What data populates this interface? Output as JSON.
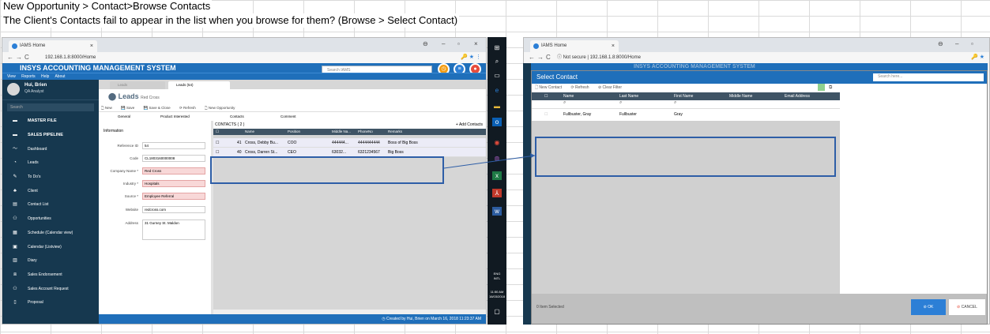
{
  "headings": {
    "line1": "New Opportunity > Contact>Browse Contacts",
    "line2": "The Client's Contacts fail to appear in the list when you browse for them? (Browse > Select Contact)"
  },
  "left": {
    "tab_title": "IAMS Home",
    "url": "192.168.1.8:8000/Home",
    "app_title": "INSYS ACCOUNTING MANAGEMENT SYSTEM",
    "menu": [
      "View",
      "Reports",
      "Help",
      "About"
    ],
    "search_placeholder": "Search IAMS",
    "user": {
      "name": "Hui, Brien",
      "role": "QA Analyst"
    },
    "sidebar_search": "Search",
    "sidebar_items": [
      {
        "label": "MASTER FILE",
        "icon": "folder-icon"
      },
      {
        "label": "SALES PIPELINE",
        "icon": "folder-open-icon"
      },
      {
        "label": "Dashboard",
        "icon": "chart-line-icon"
      },
      {
        "label": "Leads",
        "icon": "leads-icon"
      },
      {
        "label": "To Do's",
        "icon": "pencil-icon"
      },
      {
        "label": "Client",
        "icon": "users-icon"
      },
      {
        "label": "Contact List",
        "icon": "contact-card-icon"
      },
      {
        "label": "Opportunities",
        "icon": "people-icon"
      },
      {
        "label": "Schedule (Calendar view)",
        "icon": "calendar-icon"
      },
      {
        "label": "Calendar (Listview)",
        "icon": "calendar-list-icon"
      },
      {
        "label": "Diary",
        "icon": "book-icon"
      },
      {
        "label": "Sales Endorsement",
        "icon": "sitemap-icon"
      },
      {
        "label": "Sales Account Request",
        "icon": "user-plus-icon"
      },
      {
        "label": "Proposal",
        "icon": "document-icon"
      }
    ],
    "content_tabs": [
      "Leads",
      "Leads (54)"
    ],
    "leads_title": "Leads",
    "leads_sub": "Red Cross",
    "toolbar": [
      "New",
      "Save",
      "Save & Close",
      "Refresh",
      "New Opportunity"
    ],
    "subtabs": [
      "General",
      "Product Interested",
      "Contacts",
      "Comment"
    ],
    "info_label": "Information",
    "form": [
      {
        "label": "Reference ID",
        "value": "54",
        "red": false
      },
      {
        "label": "Code",
        "value": "CL1803160000008",
        "red": false
      },
      {
        "label": "Company Name *",
        "value": "Red Cross",
        "red": true
      },
      {
        "label": "Industry *",
        "value": "Hospitals",
        "red": true
      },
      {
        "label": "Source *",
        "value": "Employee Referral",
        "red": true
      },
      {
        "label": "Website",
        "value": "redcross.com",
        "red": false
      },
      {
        "label": "Address",
        "value": "31 Gurney St. Maldon",
        "red": false
      }
    ],
    "contacts_title": "CONTACTS ( 2 )",
    "add_contacts": "Add Contacts",
    "contacts_headers": [
      "Name",
      "Position",
      "Middle Na...",
      "PhoneNo",
      "Remarks"
    ],
    "contacts_rows": [
      {
        "id": "41",
        "name": "Cross, Debby Bu...",
        "position": "COO",
        "middle": "444444...",
        "phone": "4444444444",
        "remarks": "Boss of Big Boss"
      },
      {
        "id": "40",
        "name": "Cross, Darren St...",
        "position": "CEO",
        "middle": "63032...",
        "phone": "6321234567",
        "remarks": "Big Boss"
      }
    ],
    "footer": "Created by Hui, Brien on March 16, 2018 11:23:37 AM"
  },
  "taskbar": {
    "lang": "ENG",
    "locale": "INTL",
    "time": "11:50 AM",
    "date": "16/03/2018"
  },
  "right": {
    "tab_title": "IAMS Home",
    "not_secure": "Not secure",
    "url": "192.168.1.8:8000/Home",
    "behind_title": "INSYS ACCOUNTING MANAGEMENT SYSTEM",
    "dialog_title": "Select Contact",
    "dialog_search": "Search here...",
    "toolbar": [
      "New Contact",
      "Refresh",
      "Clear Filter"
    ],
    "headers": [
      "Name",
      "Last Name",
      "First Name",
      "Middle Name",
      "Email Address"
    ],
    "row": {
      "name": "Fullbuster, Gray",
      "last": "Fullbuster",
      "first": "Gray"
    },
    "status": "0 Item Selected",
    "ok": "OK",
    "cancel": "CANCEL"
  }
}
